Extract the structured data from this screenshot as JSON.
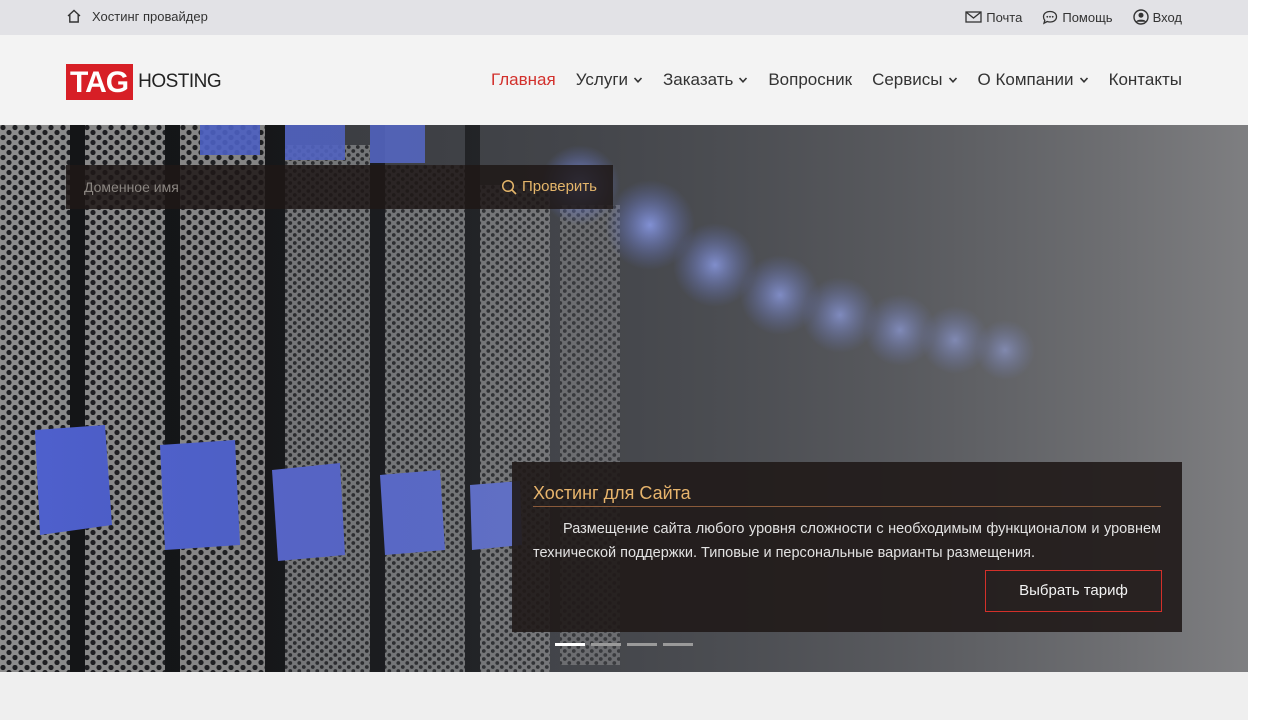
{
  "topbar": {
    "home_label": "Хостинг провайдер",
    "links": [
      {
        "label": "Почта",
        "icon": "mail-icon"
      },
      {
        "label": "Помощь",
        "icon": "chat-icon"
      },
      {
        "label": "Вход",
        "icon": "user-icon"
      }
    ]
  },
  "logo": {
    "mark": "TAG",
    "text": "HOSTING"
  },
  "nav": {
    "items": [
      {
        "label": "Главная",
        "active": true,
        "dropdown": false
      },
      {
        "label": "Услуги",
        "dropdown": true
      },
      {
        "label": "Заказать",
        "dropdown": true
      },
      {
        "label": "Вопросник",
        "dropdown": false
      },
      {
        "label": "Сервисы",
        "dropdown": true
      },
      {
        "label": "О Компании",
        "dropdown": true
      },
      {
        "label": "Контакты",
        "dropdown": false
      }
    ]
  },
  "search": {
    "placeholder": "Доменное имя",
    "button_label": "Проверить"
  },
  "slide": {
    "title": "Хостинг для Сайта",
    "description": "Размещение сайта любого уровня сложности с необходимым функционалом и уровнем технической поддержки. Типовые и персональные варианты размещения.",
    "cta_label": "Выбрать тариф",
    "dots_total": 4,
    "active_index": 0
  },
  "colors": {
    "accent": "#d2302c",
    "gold": "#e7b46c",
    "topbar_bg": "#e2e2e6",
    "header_bg": "#f3f3f3"
  }
}
